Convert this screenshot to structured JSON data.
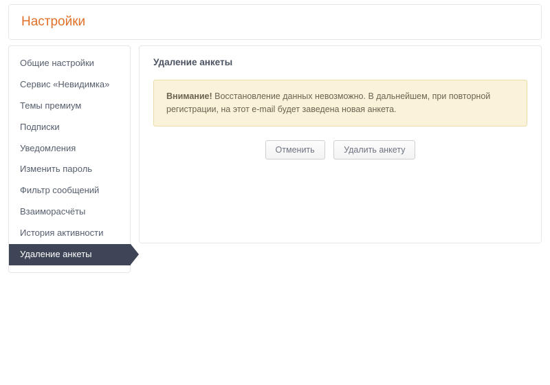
{
  "header": {
    "title": "Настройки"
  },
  "sidebar": {
    "items": [
      {
        "label": "Общие настройки",
        "active": false
      },
      {
        "label": "Сервис «Невидимка»",
        "active": false
      },
      {
        "label": "Темы премиум",
        "active": false
      },
      {
        "label": "Подписки",
        "active": false
      },
      {
        "label": "Уведомления",
        "active": false
      },
      {
        "label": "Изменить пароль",
        "active": false
      },
      {
        "label": "Фильтр сообщений",
        "active": false
      },
      {
        "label": "Взаиморасчёты",
        "active": false
      },
      {
        "label": "История активности",
        "active": false
      },
      {
        "label": "Удаление анкеты",
        "active": true
      }
    ]
  },
  "content": {
    "title": "Удаление анкеты",
    "alert_strong": "Внимание!",
    "alert_text": " Восстановление данных невозможно. В дальнейшем, при повторной регистрации, на этот e-mail будет заведена новая анкета.",
    "cancel_label": "Отменить",
    "delete_label": "Удалить анкету"
  }
}
